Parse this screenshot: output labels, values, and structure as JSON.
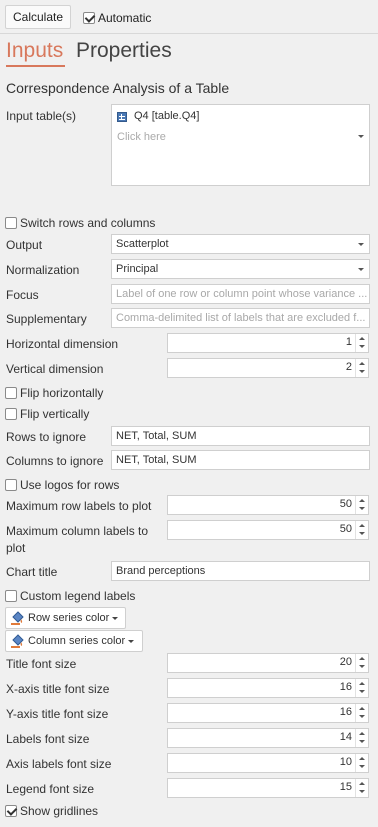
{
  "toolbar": {
    "calculate_label": "Calculate",
    "automatic_label": "Automatic",
    "automatic_checked": true
  },
  "tabs": {
    "inputs": "Inputs",
    "properties": "Properties"
  },
  "section_title": "Correspondence Analysis of a Table",
  "input_tables": {
    "label": "Input table(s)",
    "item": "Q4 [table.Q4]",
    "placeholder": "Click here"
  },
  "switch_rows": {
    "label": "Switch rows and columns",
    "checked": false
  },
  "output": {
    "label": "Output",
    "value": "Scatterplot"
  },
  "normalization": {
    "label": "Normalization",
    "value": "Principal"
  },
  "focus": {
    "label": "Focus",
    "placeholder": "Label of one row or column point whose variance ..."
  },
  "supplementary": {
    "label": "Supplementary",
    "placeholder": "Comma-delimited list of labels that are excluded f..."
  },
  "horizontal_dimension": {
    "label": "Horizontal dimension",
    "value": "1"
  },
  "vertical_dimension": {
    "label": "Vertical dimension",
    "value": "2"
  },
  "flip_horizontally": {
    "label": "Flip horizontally",
    "checked": false
  },
  "flip_vertically": {
    "label": "Flip vertically",
    "checked": false
  },
  "rows_to_ignore": {
    "label": "Rows to ignore",
    "value": "NET, Total, SUM"
  },
  "columns_to_ignore": {
    "label": "Columns to ignore",
    "value": "NET, Total, SUM"
  },
  "use_logos": {
    "label": "Use logos for rows",
    "checked": false
  },
  "max_row_labels": {
    "label": "Maximum row labels to plot",
    "value": "50"
  },
  "max_col_labels": {
    "label_line1": "Maximum column labels to",
    "label_line2": "plot",
    "value": "50"
  },
  "chart_title": {
    "label": "Chart title",
    "value": "Brand perceptions"
  },
  "custom_legend": {
    "label": "Custom legend labels",
    "checked": false
  },
  "row_series_color": {
    "label": "Row series color"
  },
  "column_series_color": {
    "label": "Column series color"
  },
  "title_font_size": {
    "label": "Title font size",
    "value": "20"
  },
  "x_axis_title_font_size": {
    "label": "X-axis title font size",
    "value": "16"
  },
  "y_axis_title_font_size": {
    "label": "Y-axis title font size",
    "value": "16"
  },
  "labels_font_size": {
    "label": "Labels font size",
    "value": "14"
  },
  "axis_labels_font_size": {
    "label": "Axis labels font size",
    "value": "10"
  },
  "legend_font_size": {
    "label": "Legend font size",
    "value": "15"
  },
  "show_gridlines": {
    "label": "Show gridlines",
    "checked": true
  },
  "colors": {
    "accent": "#d8785c",
    "background": "#f0f0f0",
    "field_border": "#cfcfcf"
  }
}
